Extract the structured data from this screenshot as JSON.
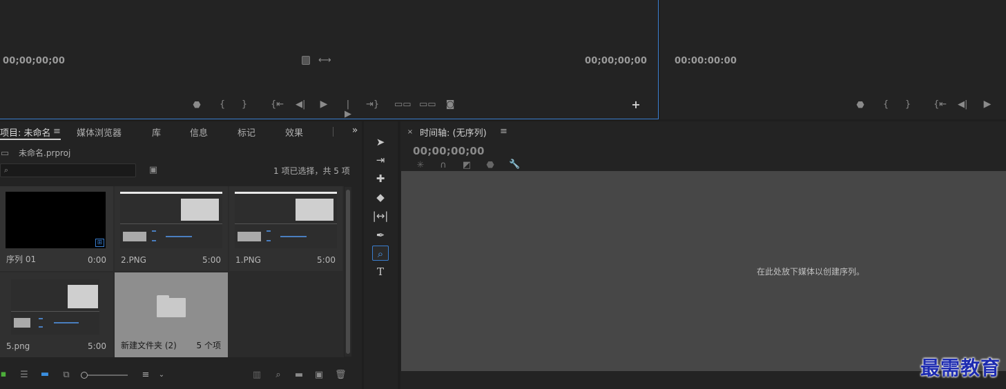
{
  "source_monitor": {
    "timecode_left": "00;00;00;00",
    "timecode_right": "00;00;00;00"
  },
  "program_monitor": {
    "timecode": "00:00:00:00"
  },
  "project_panel": {
    "tabs": [
      {
        "label": "项目: 未命名",
        "active": true
      },
      {
        "label": "媒体浏览器"
      },
      {
        "label": "库"
      },
      {
        "label": "信息"
      },
      {
        "label": "标记"
      },
      {
        "label": "效果"
      }
    ],
    "project_file": "未命名.prproj",
    "search_placeholder": "",
    "selection_status": "1 项已选择，共 5 项",
    "items": [
      {
        "name": "序列 01",
        "duration": "0:00",
        "kind": "sequence"
      },
      {
        "name": "2.PNG",
        "duration": "5:00",
        "kind": "image"
      },
      {
        "name": "1.PNG",
        "duration": "5:00",
        "kind": "image"
      },
      {
        "name": "5.png",
        "duration": "5:00",
        "kind": "image"
      },
      {
        "name": "新建文件夹 (2)",
        "duration": "5 个项",
        "kind": "folder"
      }
    ]
  },
  "timeline": {
    "title": "时间轴: (无序列)",
    "timecode": "00;00;00;00",
    "empty_message": "在此处放下媒体以创建序列。"
  },
  "watermark": "最需教育",
  "colors": {
    "accent": "#3a7fd0",
    "panel_bg": "#232323",
    "drop_area": "#474747",
    "watermark": "#1d2bb0"
  }
}
